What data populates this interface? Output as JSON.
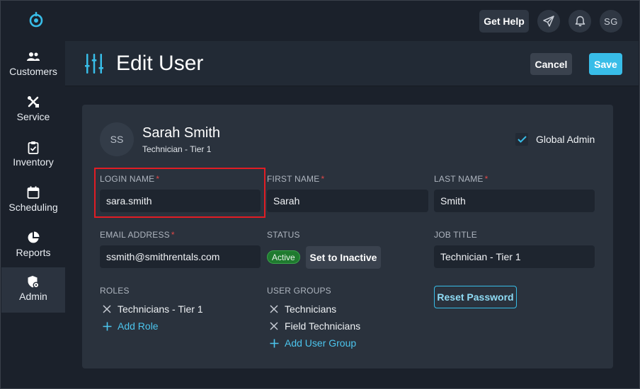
{
  "sidebar": {
    "items": [
      {
        "label": "Customers",
        "icon": "people-icon"
      },
      {
        "label": "Service",
        "icon": "tools-icon"
      },
      {
        "label": "Inventory",
        "icon": "clipboard-check-icon"
      },
      {
        "label": "Scheduling",
        "icon": "calendar-icon"
      },
      {
        "label": "Reports",
        "icon": "pie-chart-icon"
      },
      {
        "label": "Admin",
        "icon": "shield-gear-icon",
        "active": true
      }
    ]
  },
  "topbar": {
    "help_label": "Get Help",
    "avatar_initials": "SG"
  },
  "header": {
    "title": "Edit User",
    "cancel_label": "Cancel",
    "save_label": "Save"
  },
  "user": {
    "initials": "SS",
    "name": "Sarah Smith",
    "role": "Technician - Tier 1",
    "global_admin_label": "Global Admin",
    "global_admin_checked": true
  },
  "form": {
    "login_name": {
      "label": "LOGIN NAME",
      "required": "*",
      "value": "sara.smith"
    },
    "first_name": {
      "label": "FIRST NAME",
      "required": "*",
      "value": "Sarah"
    },
    "last_name": {
      "label": "LAST NAME",
      "required": "*",
      "value": "Smith"
    },
    "email": {
      "label": "EMAIL ADDRESS",
      "required": "*",
      "value": "ssmith@smithrentals.com"
    },
    "status": {
      "label": "STATUS",
      "badge": "Active",
      "toggle_label": "Set to Inactive"
    },
    "job_title": {
      "label": "JOB TITLE",
      "value": "Technician - Tier 1"
    },
    "reset_password_label": "Reset Password",
    "roles": {
      "label": "ROLES",
      "items": [
        "Technicians - Tier 1"
      ],
      "add_label": "Add Role"
    },
    "user_groups": {
      "label": "USER GROUPS",
      "items": [
        "Technicians",
        "Field Technicians"
      ],
      "add_label": "Add User Group"
    }
  },
  "colors": {
    "accent": "#38bde8",
    "background": "#1b212b",
    "card": "#2a323d",
    "highlight": "#e11d24",
    "active_badge": "#1f7a2f"
  }
}
